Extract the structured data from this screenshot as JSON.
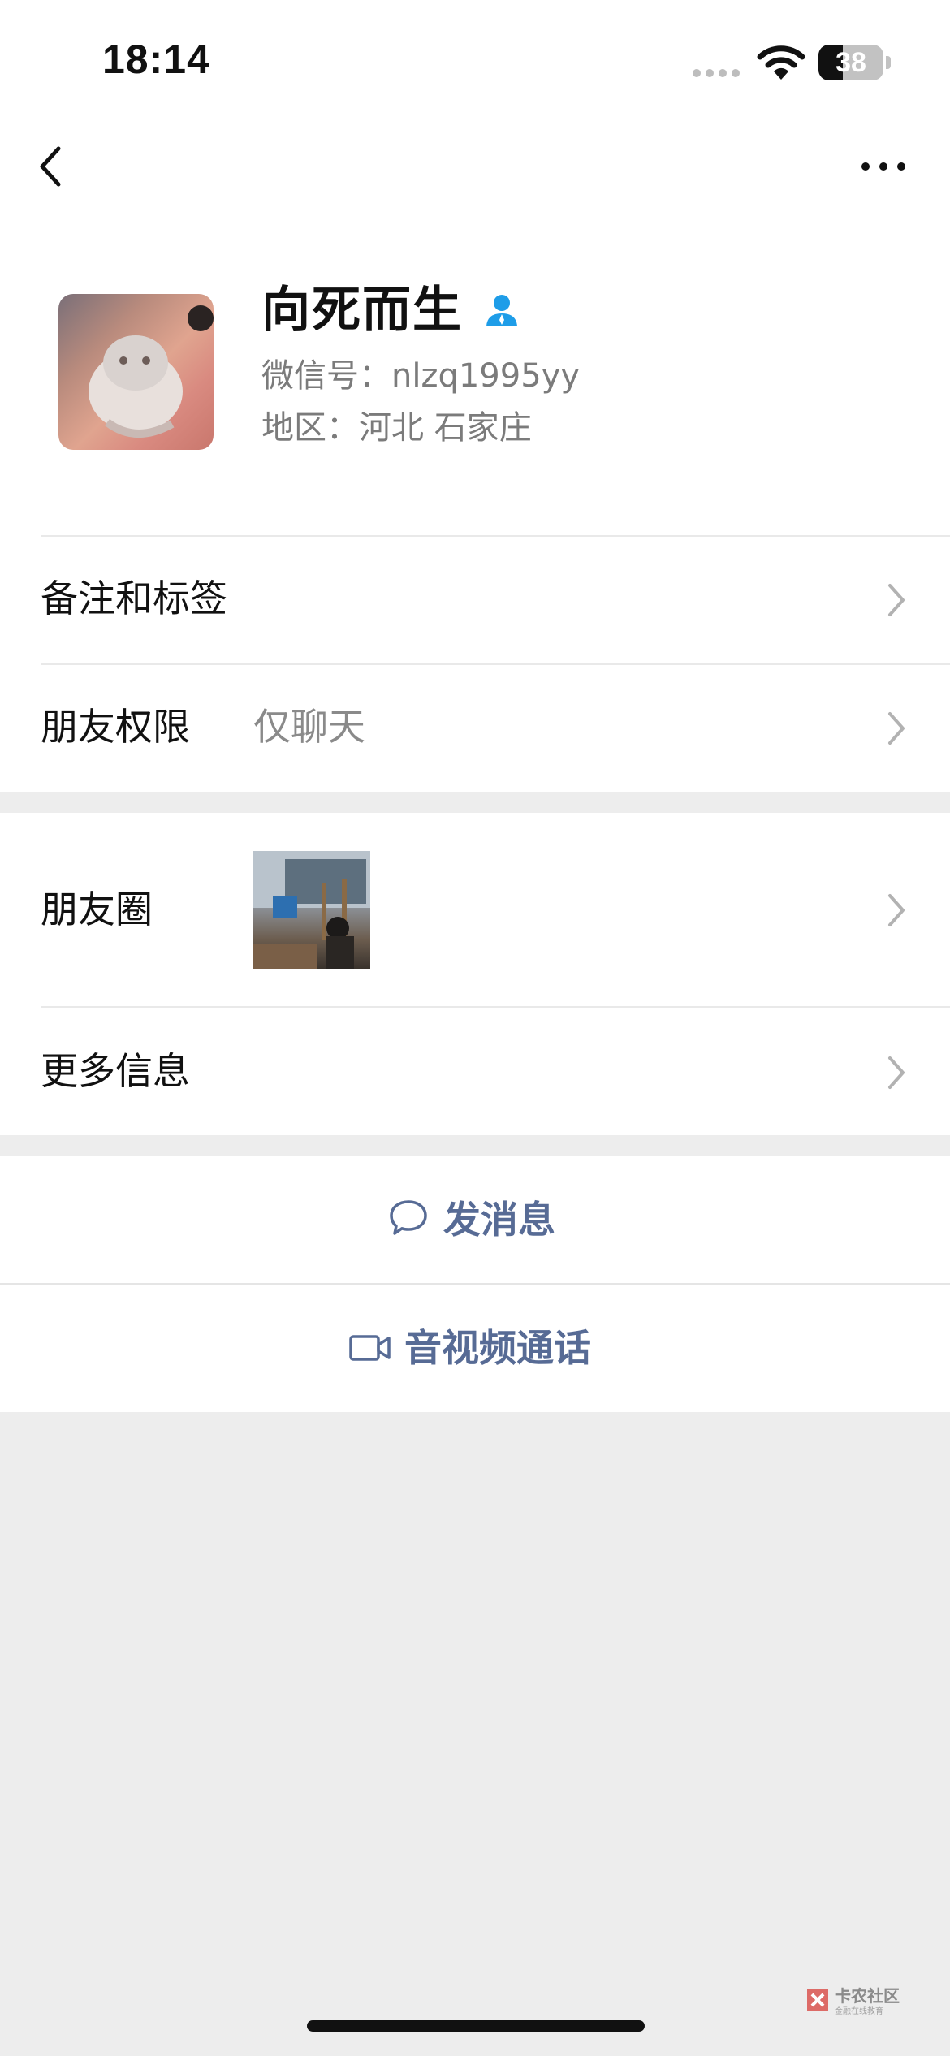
{
  "status_bar": {
    "time": "18:14",
    "battery_percent": "38",
    "battery_level": 0.38
  },
  "nav": {
    "back_icon": "chevron-left-icon",
    "more_icon": "ellipsis-icon"
  },
  "profile": {
    "nickname": "向死而生",
    "wechat_id": "微信号：nlzq1995yy",
    "region": "地区：河北 石家庄",
    "badge_icon": "person-icon",
    "badge_color": "#1e9de8"
  },
  "rows": {
    "remark": {
      "label": "备注和标签"
    },
    "permission": {
      "label": "朋友权限",
      "value": "仅聊天"
    },
    "moments": {
      "label": "朋友圈"
    },
    "more_info": {
      "label": "更多信息"
    }
  },
  "actions": {
    "message": {
      "label": "发消息",
      "icon": "chat-bubble-icon"
    },
    "call": {
      "label": "音视频通话",
      "icon": "video-camera-icon"
    }
  },
  "watermark": {
    "title": "卡农社区",
    "subtitle": "金融在线教育"
  },
  "colors": {
    "link": "#576b95",
    "background": "#ededed"
  }
}
